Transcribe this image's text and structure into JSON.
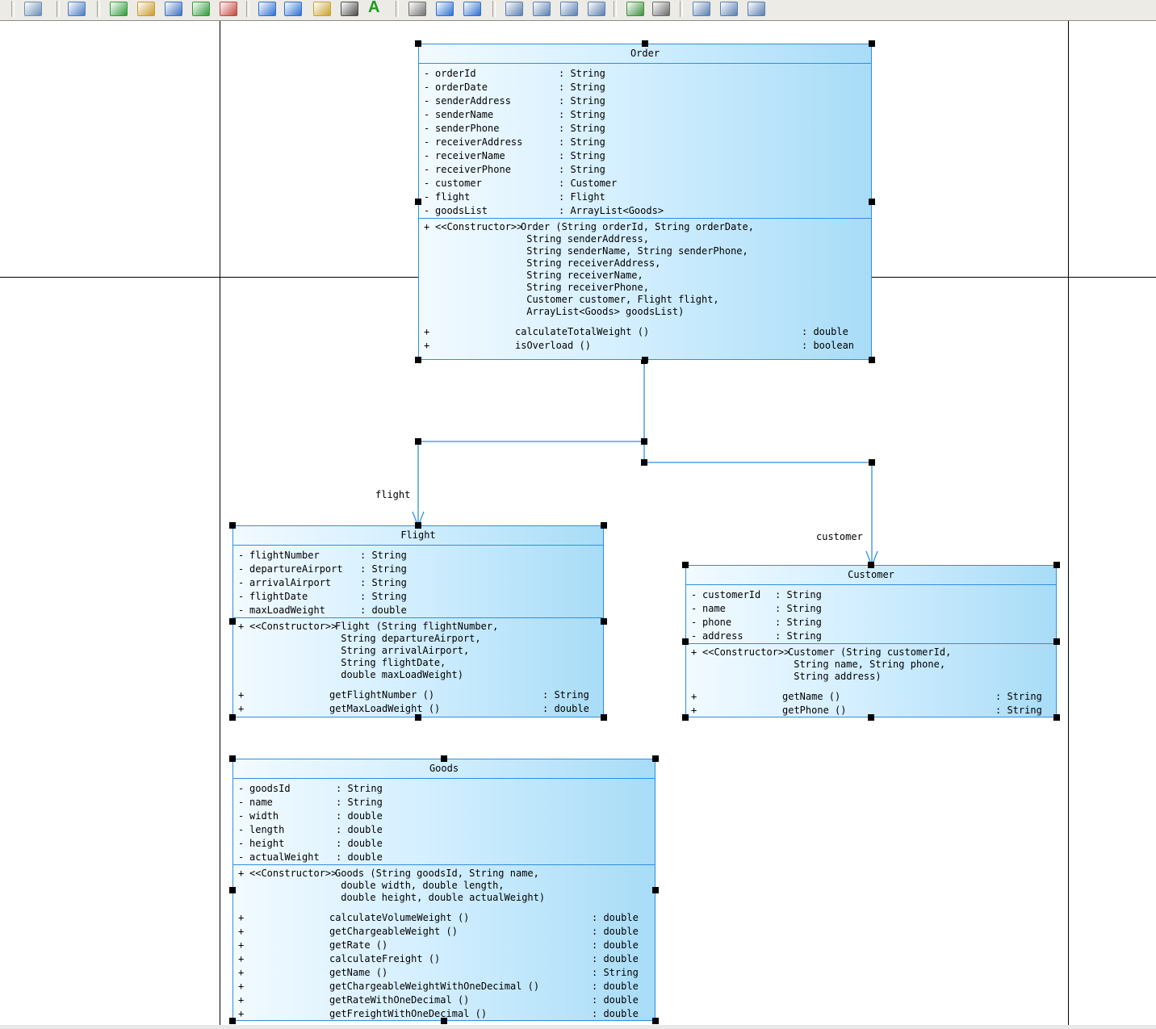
{
  "diagram": {
    "classes": {
      "order": {
        "name": "Order",
        "attributes": [
          {
            "vis": "-",
            "name": "orderId",
            "type": ": String"
          },
          {
            "vis": "-",
            "name": "orderDate",
            "type": ": String"
          },
          {
            "vis": "-",
            "name": "senderAddress",
            "type": ": String"
          },
          {
            "vis": "-",
            "name": "senderName",
            "type": ": String"
          },
          {
            "vis": "-",
            "name": "senderPhone",
            "type": ": String"
          },
          {
            "vis": "-",
            "name": "receiverAddress",
            "type": ": String"
          },
          {
            "vis": "-",
            "name": "receiverName",
            "type": ": String"
          },
          {
            "vis": "-",
            "name": "receiverPhone",
            "type": ": String"
          },
          {
            "vis": "-",
            "name": "customer",
            "type": ": Customer"
          },
          {
            "vis": "-",
            "name": "flight",
            "type": ": Flight"
          },
          {
            "vis": "-",
            "name": "goodsList",
            "type": ": ArrayList<Goods>"
          }
        ],
        "constructor": {
          "vis": "+",
          "stereotype": "<<Constructor>>",
          "signature": "Order (String orderId, String orderDate,\n String senderAddress,\n String senderName, String senderPhone,\n String receiverAddress,\n String receiverName,\n String receiverPhone,\n Customer customer, Flight flight,\n ArrayList<Goods> goodsList)"
        },
        "methods": [
          {
            "vis": "+",
            "name": "calculateTotalWeight ()",
            "ret": ": double"
          },
          {
            "vis": "+",
            "name": "isOverload ()",
            "ret": ": boolean"
          }
        ]
      },
      "flight": {
        "name": "Flight",
        "attributes": [
          {
            "vis": "-",
            "name": "flightNumber",
            "type": ": String"
          },
          {
            "vis": "-",
            "name": "departureAirport",
            "type": ": String"
          },
          {
            "vis": "-",
            "name": "arrivalAirport",
            "type": ": String"
          },
          {
            "vis": "-",
            "name": "flightDate",
            "type": ": String"
          },
          {
            "vis": "-",
            "name": "maxLoadWeight",
            "type": ": double"
          }
        ],
        "constructor": {
          "vis": "+",
          "stereotype": "<<Constructor>>",
          "signature": "Flight (String flightNumber,\n String departureAirport,\n String arrivalAirport,\n String flightDate,\n double maxLoadWeight)"
        },
        "methods": [
          {
            "vis": "+",
            "name": "getFlightNumber ()",
            "ret": ": String"
          },
          {
            "vis": "+",
            "name": "getMaxLoadWeight ()",
            "ret": ": double"
          }
        ]
      },
      "customer": {
        "name": "Customer",
        "attributes": [
          {
            "vis": "-",
            "name": "customerId",
            "type": ": String"
          },
          {
            "vis": "-",
            "name": "name",
            "type": ": String"
          },
          {
            "vis": "-",
            "name": "phone",
            "type": ": String"
          },
          {
            "vis": "-",
            "name": "address",
            "type": ": String"
          }
        ],
        "constructor": {
          "vis": "+",
          "stereotype": "<<Constructor>>",
          "signature": "Customer (String customerId,\n String name, String phone,\n String address)"
        },
        "methods": [
          {
            "vis": "+",
            "name": "getName ()",
            "ret": ": String"
          },
          {
            "vis": "+",
            "name": "getPhone ()",
            "ret": ": String"
          }
        ]
      },
      "goods": {
        "name": "Goods",
        "attributes": [
          {
            "vis": "-",
            "name": "goodsId",
            "type": ": String"
          },
          {
            "vis": "-",
            "name": "name",
            "type": ": String"
          },
          {
            "vis": "-",
            "name": "width",
            "type": ": double"
          },
          {
            "vis": "-",
            "name": "length",
            "type": ": double"
          },
          {
            "vis": "-",
            "name": "height",
            "type": ": double"
          },
          {
            "vis": "-",
            "name": "actualWeight",
            "type": ": double"
          }
        ],
        "constructor": {
          "vis": "+",
          "stereotype": "<<Constructor>>",
          "signature": "Goods (String goodsId, String name,\n double width, double length,\n double height, double actualWeight)"
        },
        "methods": [
          {
            "vis": "+",
            "name": "calculateVolumeWeight ()",
            "ret": ": double"
          },
          {
            "vis": "+",
            "name": "getChargeableWeight ()",
            "ret": ": double"
          },
          {
            "vis": "+",
            "name": "getRate ()",
            "ret": ": double"
          },
          {
            "vis": "+",
            "name": "calculateFreight ()",
            "ret": ": double"
          },
          {
            "vis": "+",
            "name": "getName ()",
            "ret": ": String"
          },
          {
            "vis": "+",
            "name": "getChargeableWeightWithOneDecimal ()",
            "ret": ": double"
          },
          {
            "vis": "+",
            "name": "getRateWithOneDecimal ()",
            "ret": ": double"
          },
          {
            "vis": "+",
            "name": "getFreightWithOneDecimal ()",
            "ret": ": double"
          }
        ]
      }
    },
    "associations": [
      {
        "from": "Order",
        "to": "Flight",
        "role": "flight"
      },
      {
        "from": "Order",
        "to": "Customer",
        "role": "customer"
      }
    ]
  },
  "toolbar": {
    "icons": [
      "properties-icon",
      "settings-icon",
      "package-icon",
      "import-icon",
      "find-icon",
      "refresh-icon",
      "check-icon",
      "copy-icon",
      "layout-icon",
      "pencil-icon",
      "paint-icon",
      "text-icon",
      "square-icon",
      "undo-icon",
      "redo-icon",
      "zoom-fit-icon",
      "zoom-in-icon",
      "zoom-out-icon",
      "zoom-page-icon",
      "export-icon",
      "print-icon",
      "preview-icon",
      "report-icon",
      "list-icon"
    ],
    "text_tool_glyph": "A"
  },
  "colors": {
    "class_border": "#2f8ee0",
    "class_fill_light": "#f2faff",
    "class_fill_dark": "#a8dcf7",
    "association_line": "#2f8ee0"
  }
}
